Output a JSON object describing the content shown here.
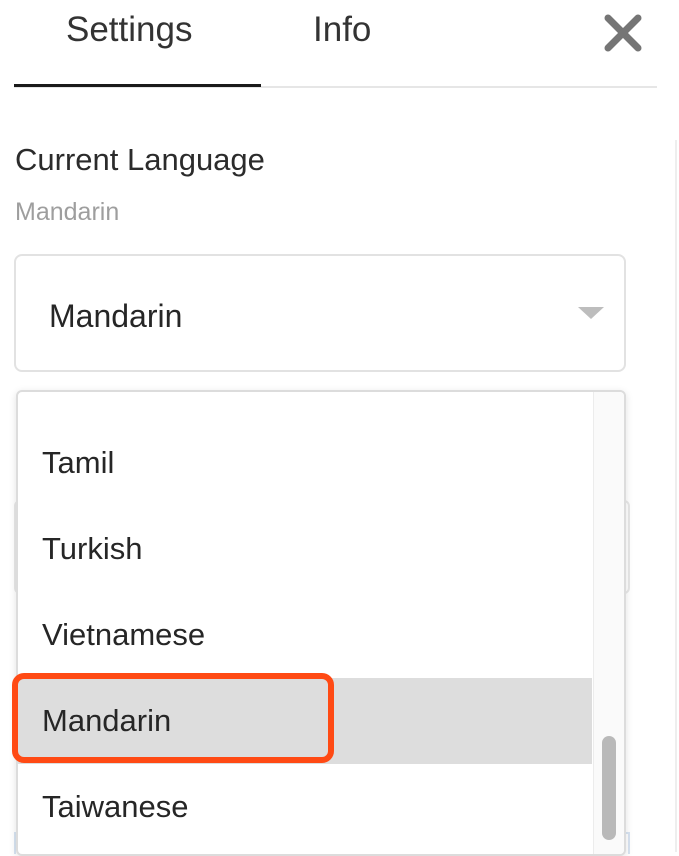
{
  "tabs": [
    {
      "label": "Settings",
      "active": true
    },
    {
      "label": "Info",
      "active": false
    }
  ],
  "close_icon": "close-x-icon",
  "language": {
    "title": "Current Language",
    "current_value": "Mandarin",
    "select_value": "Mandarin",
    "options": [
      "Tamil",
      "Turkish",
      "Vietnamese",
      "Mandarin",
      "Taiwanese"
    ],
    "selected_option": "Mandarin"
  },
  "colors": {
    "highlight": "#ff4a14",
    "selected_bg": "#dddddd",
    "muted_text": "#9e9e9e"
  }
}
